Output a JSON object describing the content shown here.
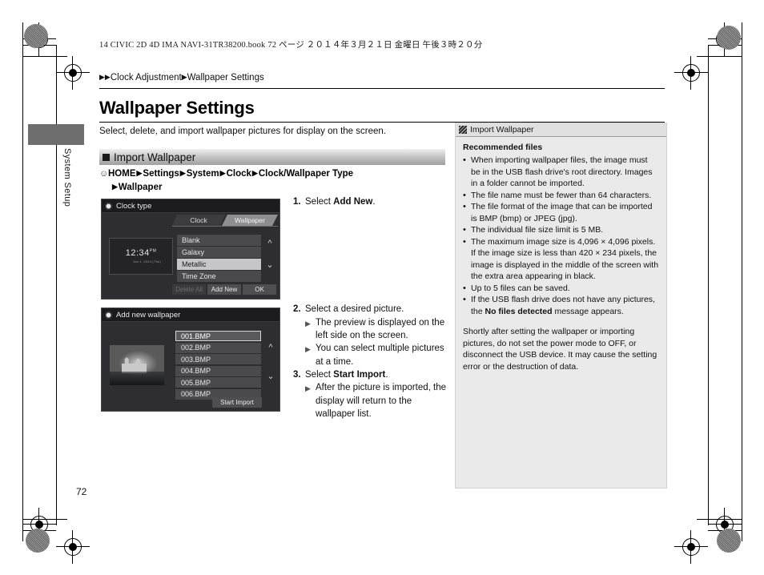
{
  "book_header": "14 CIVIC 2D 4D IMA NAVI-31TR38200.book   72 ページ   ２０１４年３月２１日   金曜日   午後３時２０分",
  "thumb_tab": {
    "label": "System Setup"
  },
  "breadcrumb": {
    "level1": "Clock Adjustment",
    "level2": "Wallpaper Settings"
  },
  "page_title": "Wallpaper Settings",
  "intro": "Select, delete, and import wallpaper pictures for display on the screen.",
  "section": {
    "title": "Import Wallpaper"
  },
  "nav_path": {
    "hand_icon": "hand-pointer-icon",
    "items": [
      "HOME",
      "Settings",
      "System",
      "Clock",
      "Clock/Wallpaper Type"
    ],
    "second_line": "Wallpaper"
  },
  "device_clock": {
    "title": "Clock type",
    "gear_icon": "gear-icon",
    "tabs": [
      {
        "label": "Clock",
        "active": false
      },
      {
        "label": "Wallpaper",
        "active": true
      }
    ],
    "preview": {
      "time": "12:34",
      "suffix": "PM",
      "subtext": "Jan 1, 2014 (Thu)"
    },
    "list": [
      {
        "label": "Blank",
        "selected": false
      },
      {
        "label": "Galaxy",
        "selected": false
      },
      {
        "label": "Metallic",
        "selected": true
      },
      {
        "label": "Time Zone",
        "selected": false
      }
    ],
    "scroll_up_icon": "chevron-up-icon",
    "scroll_down_icon": "chevron-down-icon",
    "buttons": [
      {
        "label": "Delete All",
        "disabled": true
      },
      {
        "label": "Add New",
        "disabled": false
      },
      {
        "label": "OK",
        "disabled": false
      }
    ]
  },
  "device_add": {
    "title": "Add new wallpaper",
    "gear_icon": "gear-icon",
    "preview_alt": "castle-photo-thumbnail",
    "files": [
      {
        "label": "001.BMP",
        "selected": true
      },
      {
        "label": "002.BMP",
        "selected": false
      },
      {
        "label": "003.BMP",
        "selected": false
      },
      {
        "label": "004.BMP",
        "selected": false
      },
      {
        "label": "005.BMP",
        "selected": false
      },
      {
        "label": "006.BMP",
        "selected": false
      }
    ],
    "scroll_up_icon": "chevron-up-icon",
    "scroll_down_icon": "chevron-down-icon",
    "start_button": "Start Import"
  },
  "steps": {
    "s1_num": "1.",
    "s1_pre": "Select ",
    "s1_bold": "Add New",
    "s1_post": ".",
    "s2_num": "2.",
    "s2_text": "Select a desired picture.",
    "s2_b1": "The preview is displayed on the left side on the screen.",
    "s2_b2": "You can select multiple pictures at a time.",
    "s3_num": "3.",
    "s3_pre": "Select ",
    "s3_bold": "Start Import",
    "s3_post": ".",
    "s3_b1": "After the picture is imported, the display will return to the wallpaper list."
  },
  "info_panel": {
    "icon": "note-icon",
    "title": "Import Wallpaper",
    "heading": "Recommended files",
    "bullets": [
      "When importing wallpaper files, the image must be in the USB flash drive's root directory. Images in a folder cannot be imported.",
      "The file name must be fewer than 64 characters.",
      "The file format of the image that can be imported is BMP (bmp) or JPEG (jpg).",
      "The individual file size limit is 5 MB.",
      "The maximum image size is 4,096 × 4,096 pixels. If the image size is less than 420 × 234 pixels, the image is displayed in the middle of the screen with the extra area appearing in black.",
      "Up to 5 files can be saved."
    ],
    "bullet_last_pre": "If the USB flash drive does not have any pictures, the ",
    "bullet_last_bold": "No files detected",
    "bullet_last_post": " message appears.",
    "paragraph": "Shortly after setting the wallpaper or importing pictures, do not set the power mode to OFF, or disconnect the USB device. It may cause the setting error or the destruction of data."
  },
  "page_number": "72"
}
